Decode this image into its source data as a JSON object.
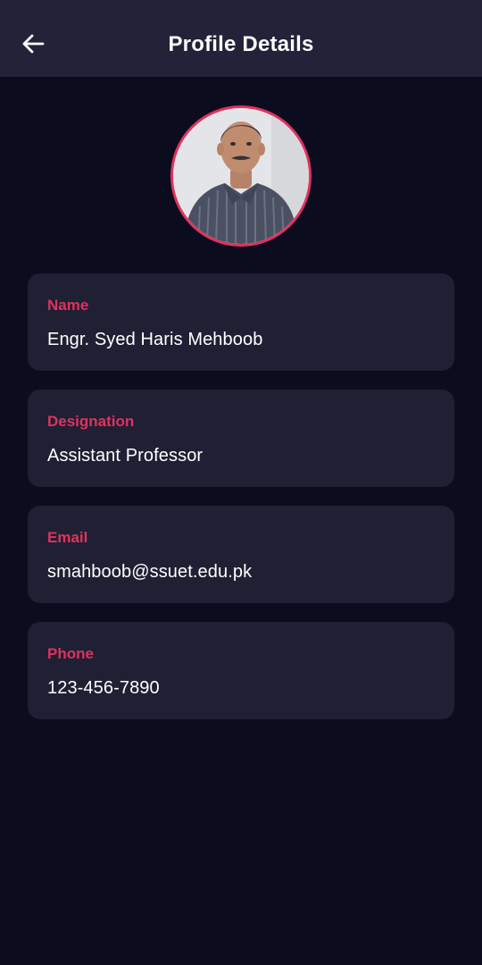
{
  "header": {
    "title": "Profile Details",
    "back_icon": "arrow-left-icon"
  },
  "avatar": {
    "icon": "avatar-photo",
    "border_color": "#e0325f"
  },
  "fields": [
    {
      "label": "Name",
      "value": "Engr. Syed Haris Mehboob"
    },
    {
      "label": "Designation",
      "value": "Assistant Professor"
    },
    {
      "label": "Email",
      "value": "smahboob@ssuet.edu.pk"
    },
    {
      "label": "Phone",
      "value": "123-456-7890"
    }
  ],
  "colors": {
    "background": "#0b0d1f",
    "header": "#222238",
    "card": "#1f2034",
    "accent": "#e0325f",
    "text": "#ffffff"
  }
}
